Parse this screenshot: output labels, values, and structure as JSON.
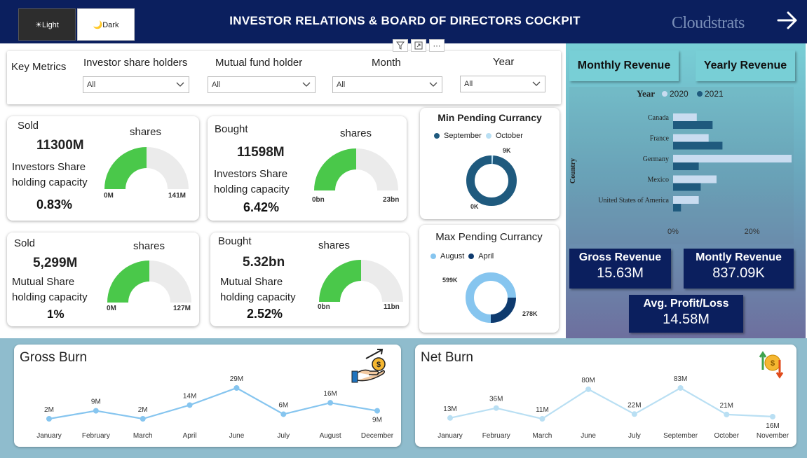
{
  "header": {
    "light_label": "☀Light",
    "dark_label": "🌙Dark",
    "title": "INVESTOR RELATIONS & BOARD OF DIRECTORS COCKPIT",
    "logo_text": "Cloudstrats",
    "bg_color": "#0b1f5e"
  },
  "filters": {
    "key_metrics_label": "Key Metrics",
    "investor_label": "Investor share holders",
    "investor_value": "All",
    "mutual_label": "Mutual fund holder",
    "mutual_value": "All",
    "month_label": "Month",
    "month_value": "All",
    "year_label": "Year",
    "year_value": "All"
  },
  "gauges": [
    {
      "title": "Sold",
      "value": "11300M",
      "value_color": "#8b0000",
      "unit": "shares",
      "cap1": "Investors Share",
      "cap2": "holding capacity",
      "pct": "0.83%",
      "min": "0M",
      "max": "141M",
      "fill_fraction": 0.5
    },
    {
      "title": "Bought",
      "value": "11598M",
      "value_color": "#1e7e1e",
      "unit": "shares",
      "cap1": "Investors Share",
      "cap2": "holding capacity",
      "pct": "6.42%",
      "min": "0bn",
      "max": "23bn",
      "fill_fraction": 0.5
    },
    {
      "title": "Sold",
      "value": "5,299M",
      "value_color": "#8b0000",
      "unit": "shares",
      "cap1": "Mutual Share",
      "cap2": "holding capacity",
      "pct": "1%",
      "min": "0M",
      "max": "127M",
      "fill_fraction": 0.5
    },
    {
      "title": "Bought",
      "value": "5.32bn",
      "value_color": "#1e7e1e",
      "unit": "shares",
      "cap1": "Mutual Share",
      "cap2": "holding capacity",
      "pct": "2.52%",
      "min": "0bn",
      "max": "11bn",
      "fill_fraction": 0.5
    }
  ],
  "min_pending": {
    "title": "Min Pending Currancy",
    "legend": [
      {
        "name": "September",
        "color": "#1f5a7e"
      },
      {
        "name": "October",
        "color": "#b9dff3"
      }
    ],
    "label_top": "9K",
    "label_bottom": "0K"
  },
  "max_pending": {
    "title": "Max Pending Currancy",
    "legend": [
      {
        "name": "August",
        "color": "#86c5ef"
      },
      {
        "name": "April",
        "color": "#0e3a6e"
      }
    ],
    "label_left": "599K",
    "label_right": "278K"
  },
  "revenue": {
    "monthly_btn": "Monthly Revenue",
    "yearly_btn": "Yearly Revenue",
    "gross_label": "Gross Revenue",
    "gross_value": "15.63M",
    "monthly_label": "Montly Revenue",
    "monthly_value": "837.09K",
    "avg_label": "Avg. Profit/Loss",
    "avg_value": "14.58M"
  },
  "chart_data": [
    {
      "type": "bar",
      "orientation": "horizontal",
      "legend_title": "Year",
      "ylabel": "Country",
      "categories": [
        "Canada",
        "France",
        "Germany",
        "Mexico",
        "United States of America"
      ],
      "series": [
        {
          "name": "2020",
          "color": "#c9dcf0",
          "values": [
            6,
            9,
            30,
            11,
            6.5
          ]
        },
        {
          "name": "2021",
          "color": "#1f5a7e",
          "values": [
            10,
            12.5,
            6.5,
            7,
            2
          ]
        }
      ],
      "xticks": [
        "0%",
        "20%"
      ],
      "xlim": [
        0,
        30
      ],
      "legend_position": "top"
    },
    {
      "type": "line",
      "title": "Gross Burn",
      "x": [
        "January",
        "February",
        "March",
        "April",
        "June",
        "July",
        "August",
        "December"
      ],
      "values": [
        2,
        9,
        2,
        14,
        29,
        6,
        16,
        9
      ],
      "labels": [
        "2M",
        "9M",
        "2M",
        "14M",
        "29M",
        "6M",
        "16M",
        "9M"
      ],
      "color": "#86c5ef"
    },
    {
      "type": "line",
      "title": "Net Burn",
      "x": [
        "January",
        "February",
        "March",
        "June",
        "July",
        "September",
        "October",
        "November"
      ],
      "values": [
        13,
        36,
        11,
        80,
        22,
        83,
        21,
        16
      ],
      "labels": [
        "13M",
        "36M",
        "11M",
        "80M",
        "22M",
        "83M",
        "21M",
        "16M"
      ],
      "color": "#b9dff3"
    }
  ]
}
